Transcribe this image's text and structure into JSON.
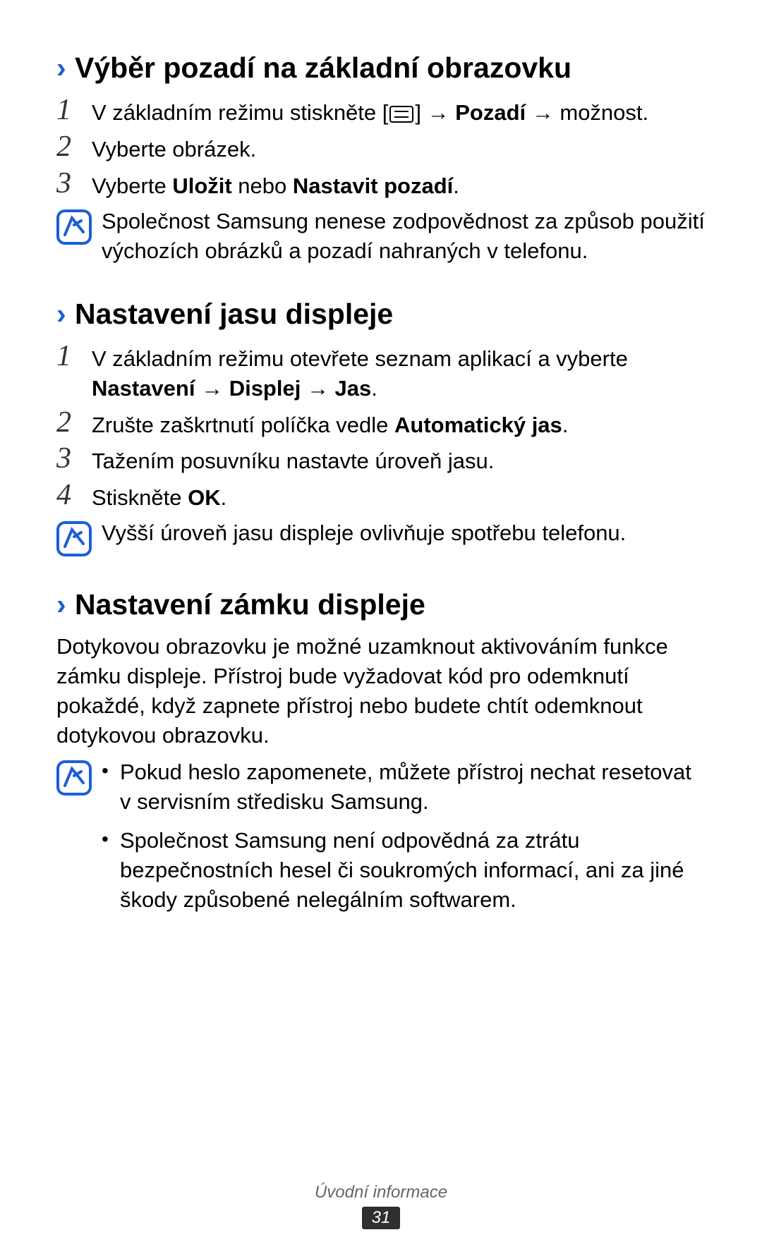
{
  "section1": {
    "heading": "Výběr pozadí na základní obrazovku",
    "steps": [
      {
        "pre": "V základním režimu stiskněte [",
        "mid": "] → ",
        "bold1": "Pozadí",
        "post": " → možnost."
      },
      {
        "text": "Vyberte obrázek."
      },
      {
        "pre": "Vyberte ",
        "bold1": "Uložit",
        "mid": " nebo ",
        "bold2": "Nastavit pozadí",
        "post": "."
      }
    ],
    "note": "Společnost Samsung nenese zodpovědnost za způsob použití výchozích obrázků a pozadí nahraných v telefonu."
  },
  "section2": {
    "heading": "Nastavení jasu displeje",
    "steps": [
      {
        "pre": "V základním režimu otevřete seznam aplikací a vyberte ",
        "bold1": "Nastavení → Displej → Jas",
        "post": "."
      },
      {
        "pre": "Zrušte zaškrtnutí políčka vedle ",
        "bold1": "Automatický jas",
        "post": "."
      },
      {
        "text": "Tažením posuvníku nastavte úroveň jasu."
      },
      {
        "pre": "Stiskněte ",
        "bold1": "OK",
        "post": "."
      }
    ],
    "note": "Vyšší úroveň jasu displeje ovlivňuje spotřebu telefonu."
  },
  "section3": {
    "heading": "Nastavení zámku displeje",
    "paragraph": "Dotykovou obrazovku je možné uzamknout aktivováním funkce zámku displeje. Přístroj bude vyžadovat kód pro odemknutí pokaždé, když zapnete přístroj nebo budete chtít odemknout dotykovou obrazovku.",
    "note_items": [
      "Pokud heslo zapomenete, můžete přístroj nechat resetovat v servisním středisku Samsung.",
      "Společnost Samsung není odpovědná za ztrátu bezpečnostních hesel či soukromých informací, ani za jiné škody způsobené nelegálním softwarem."
    ]
  },
  "footer": {
    "section_label": "Úvodní informace",
    "page_number": "31"
  }
}
